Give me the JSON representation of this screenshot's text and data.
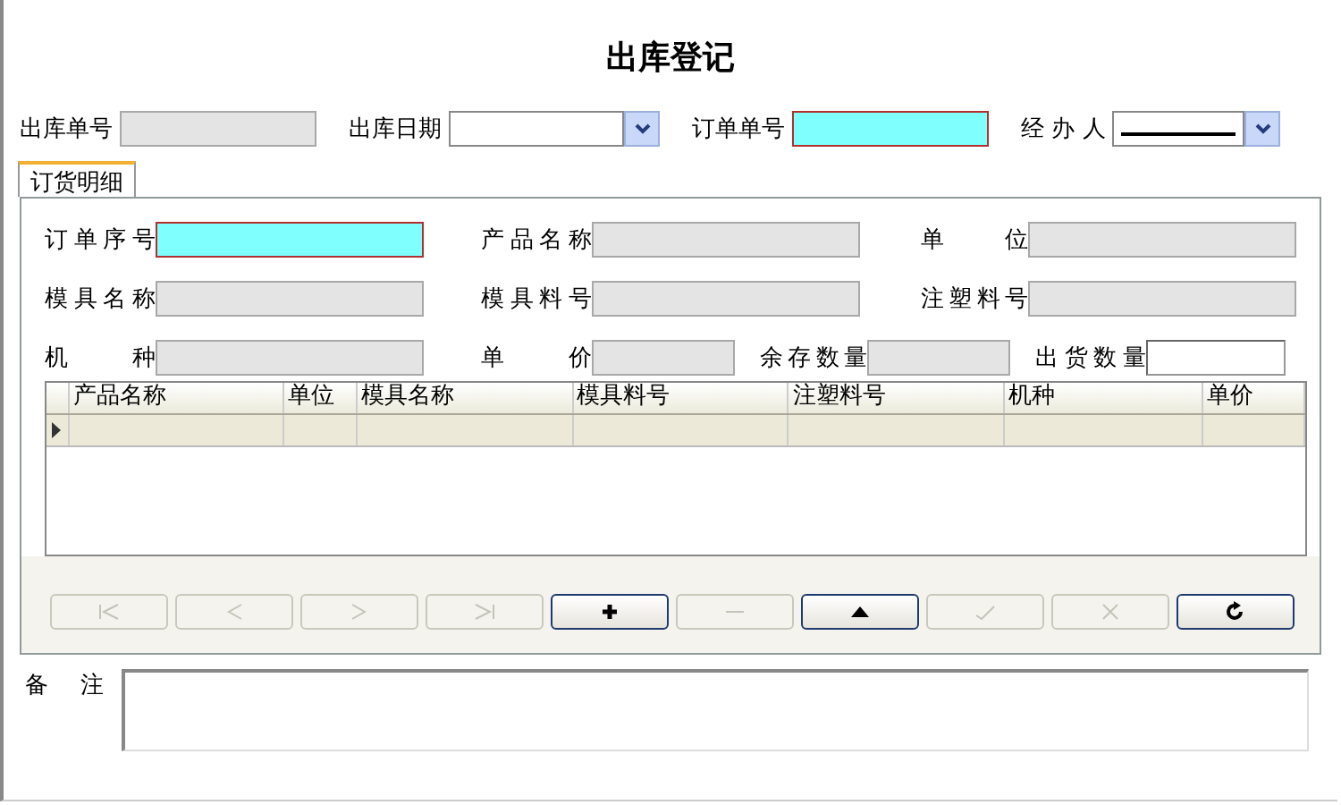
{
  "window": {
    "title": "出库登记"
  },
  "header_fields": [
    {
      "label": "出库单号",
      "kind": "readonly"
    },
    {
      "label": "出库日期",
      "kind": "date"
    },
    {
      "label": "订单单号",
      "kind": "required"
    },
    {
      "label": "经 办 人",
      "kind": "combo"
    }
  ],
  "tabs": [
    {
      "label": "订货明细",
      "selected": true
    }
  ],
  "detail_rows": [
    [
      {
        "label": "订单序号",
        "kind": "required"
      },
      {
        "label": "产品名称",
        "kind": "readonly"
      },
      {
        "label": "单 位",
        "kind": "readonly"
      }
    ],
    [
      {
        "label": "模具名称",
        "kind": "readonly"
      },
      {
        "label": "模具料号",
        "kind": "readonly"
      },
      {
        "label": "注塑料号",
        "kind": "readonly"
      }
    ],
    [
      {
        "label": "机 种",
        "kind": "readonly"
      },
      {
        "label": "单 价",
        "kind": "readonly"
      },
      {
        "label": "余存数量",
        "kind": "readonly"
      },
      {
        "label": "出货数量",
        "kind": "input"
      }
    ]
  ],
  "table": {
    "columns": [
      "产品名称",
      "单位",
      "模具名称",
      "模具料号",
      "注塑料号",
      "机种",
      "单价"
    ]
  },
  "nav_buttons": [
    {
      "kind": "first",
      "disabled": true
    },
    {
      "kind": "prev",
      "disabled": true
    },
    {
      "kind": "next",
      "disabled": true
    },
    {
      "kind": "last",
      "disabled": true
    },
    {
      "kind": "add",
      "disabled": false
    },
    {
      "kind": "delete",
      "disabled": true
    },
    {
      "kind": "edit",
      "disabled": false
    },
    {
      "kind": "post",
      "disabled": true
    },
    {
      "kind": "cancel",
      "disabled": true
    },
    {
      "kind": "refresh",
      "disabled": false
    }
  ],
  "remarks": {
    "label": "备 注"
  }
}
